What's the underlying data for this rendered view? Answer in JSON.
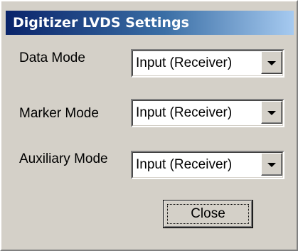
{
  "window": {
    "title": "Digitizer LVDS Settings"
  },
  "fields": [
    {
      "label": "Data Mode",
      "value": "Input (Receiver)"
    },
    {
      "label": "Marker Mode",
      "value": "Input (Receiver)"
    },
    {
      "label": "Auxiliary Mode",
      "value": "Input (Receiver)"
    }
  ],
  "buttons": {
    "close_label": "Close"
  },
  "icons": {
    "dropdown": "chevron-down-icon"
  },
  "colors": {
    "titlebar_start": "#0a246a",
    "titlebar_end": "#a6caf0",
    "dialog_face": "#d4d0c8"
  }
}
